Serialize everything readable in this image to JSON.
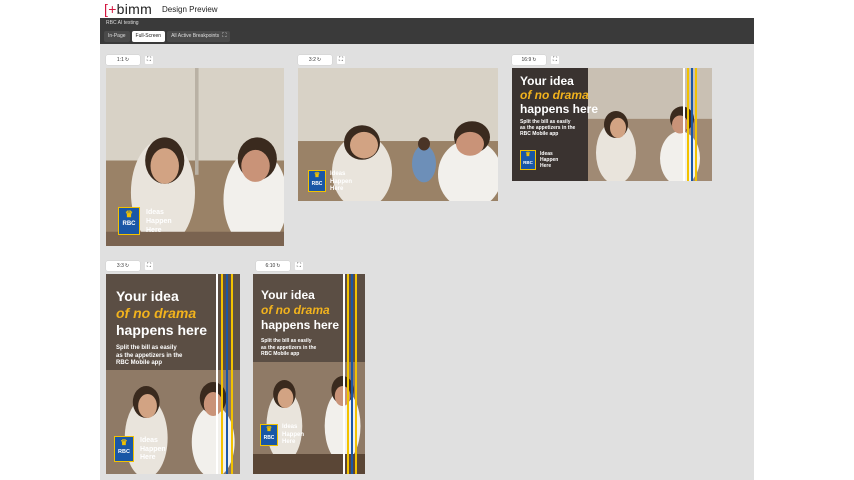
{
  "header": {
    "logo_bracket": "[+",
    "logo_text": "bimm",
    "app_title": "Design Preview"
  },
  "toolbar": {
    "project_title": "RBC AI testing",
    "tabs": [
      {
        "label": "In-Page",
        "active": false
      },
      {
        "label": "Full-Screen",
        "active": true
      },
      {
        "label": "All Active Breakpoints",
        "active": false
      }
    ],
    "expand_icon": "expand-icon"
  },
  "controls": {
    "refresh_glyph": "↻",
    "expand_glyph": "⛶",
    "ratios": [
      "1:1",
      "3:2",
      "16:9",
      "3:3",
      "6:10"
    ]
  },
  "ads": {
    "rbc_logo_text": "RBC",
    "tagline": [
      "Ideas",
      "Happen",
      "Here"
    ],
    "headline_line1": "Your idea",
    "headline_line2": "of no drama",
    "headline_line3": "happens here",
    "subcopy": [
      "Split the bill as easily",
      "as the appetizers in the",
      "RBC Mobile app"
    ]
  },
  "colors": {
    "brand_blue": "#1a57a6",
    "brand_yellow": "#f2c200",
    "drama_accent": "#f2b31d"
  }
}
